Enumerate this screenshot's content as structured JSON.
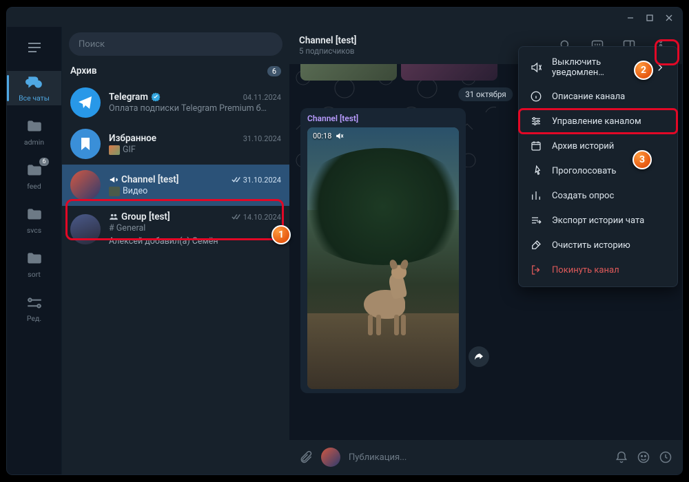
{
  "search_placeholder": "Поиск",
  "rail": {
    "all_chats": "Все чаты",
    "folders": [
      "admin",
      "feed",
      "svcs",
      "sort",
      "Ред."
    ],
    "feed_badge": "6"
  },
  "list": {
    "archive": {
      "label": "Архив",
      "count": "6"
    },
    "items": [
      {
        "name": "Telegram",
        "date": "04.11.2024",
        "sub": "Оплата подписки Telegram Premium б…"
      },
      {
        "name": "Избранное",
        "date": "31.10.2024",
        "sub": "GIF"
      },
      {
        "name": "Channel [test]",
        "date": "31.10.2024",
        "sub": "Видео"
      },
      {
        "name": "Group [test]",
        "date": "14.10.2024",
        "sub_top": "# General",
        "sub": "Алексей добавил(а) Семён"
      }
    ]
  },
  "header": {
    "title": "Channel [test]",
    "sub": "5 подписчиков"
  },
  "chat": {
    "date": "31 октября",
    "from": "Channel [test]",
    "video_time": "00:18"
  },
  "composer_placeholder": "Публикация...",
  "menu": {
    "mute": "Выключить уведомлен…",
    "desc": "Описание канала",
    "manage": "Управление каналом",
    "stories": "Архив историй",
    "vote": "Проголосовать",
    "poll": "Создать опрос",
    "export": "Экспорт истории чата",
    "clear": "Очистить историю",
    "leave": "Покинуть канал"
  }
}
